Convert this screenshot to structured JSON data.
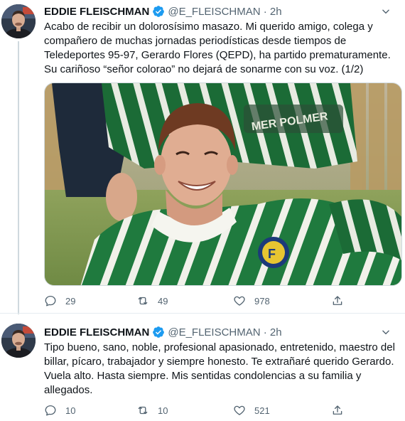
{
  "tweets": [
    {
      "author_name": "EDDIE FLEISCHMAN",
      "handle_time": "@E_FLEISCHMAN · 2h",
      "text": "Acabo de recibir un dolorosísimo masazo. Mi querido amigo, colega y compañero de muchas jornadas periodísticas desde tiempos de Teledeportes 95-97, Gerardo Flores (QEPD), ha partido prematuramente. Su cariñoso “señor colorao” no dejará de sonarme con su voz. (1/2)",
      "replies": "29",
      "retweets": "49",
      "likes": "978"
    },
    {
      "author_name": "EDDIE FLEISCHMAN",
      "handle_time": "@E_FLEISCHMAN · 2h",
      "text": "Tipo bueno, sano, noble, profesional apasionado, entretenido, maestro del billar, pícaro, trabajador y siempre honesto. Te extrañaré querido Gerardo. Vuela alto. Hasta siempre. Mis sentidas condolencias a su familia y allegados.",
      "replies": "10",
      "retweets": "10",
      "likes": "521"
    }
  ],
  "icons": {
    "verified": "verified-badge-icon",
    "more": "caret-down-icon",
    "reply": "reply-icon",
    "retweet": "retweet-icon",
    "like": "heart-icon",
    "share": "share-icon"
  },
  "colors": {
    "text": "#0f1419",
    "secondary": "#536471",
    "verified": "#1d9bf0",
    "border": "#e6ecf0",
    "jersey_green": "#1f7a3e"
  }
}
